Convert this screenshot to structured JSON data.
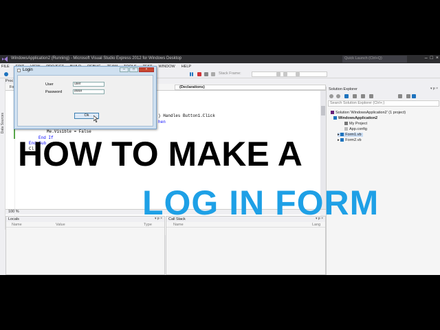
{
  "titlebar": {
    "title": "WindowsApplication2 (Running) - Microsoft Visual Studio Express 2012 for Windows Desktop",
    "quick_launch": "Quick Launch (Ctrl+Q)"
  },
  "menu": [
    "FILE",
    "EDIT",
    "VIEW",
    "PROJECT",
    "BUILD",
    "DEBUG",
    "TEAM",
    "TOOLS",
    "TEST",
    "WINDOW",
    "HELP"
  ],
  "toolbar": {
    "stack_frame": "Stack Frame:"
  },
  "side_tab": {
    "label": "Data Sources"
  },
  "editor": {
    "tab_left": "Proc",
    "tab_form": "Fo",
    "declarations": "(Declarations)",
    "code": {
      "handles": ") Handles Button1.Click",
      "then": "hen",
      "visible": "Me.Visible = False",
      "endif": "End If",
      "endsub": "End Sub",
      "cl": "Cl"
    },
    "zoom": "100 %"
  },
  "locals": {
    "title": "Locals",
    "cols": [
      "Name",
      "Value",
      "Type"
    ]
  },
  "callstack": {
    "title": "Call Stack",
    "cols": [
      "Name",
      "Lang"
    ]
  },
  "solution": {
    "title": "Solution Explorer",
    "search": "Search Solution Explorer (Ctrl+;)",
    "items": [
      "Solution 'WindowsApplication2' (1 project)",
      "WindowsApplication2",
      "My Project",
      "App.config",
      "Form1.vb",
      "Form2.vb"
    ]
  },
  "login": {
    "title": "Login",
    "user_label": "User",
    "user_value": "user",
    "password_label": "Password",
    "password_value": "####",
    "ok": "Ok"
  },
  "headline": {
    "line1": "HOW TO MAKE A",
    "line2": "LOG IN FORM"
  },
  "colors": {
    "headline_blue": "#1ea0e6",
    "titlebar": "#2d2d30",
    "accent": "#007acc"
  }
}
